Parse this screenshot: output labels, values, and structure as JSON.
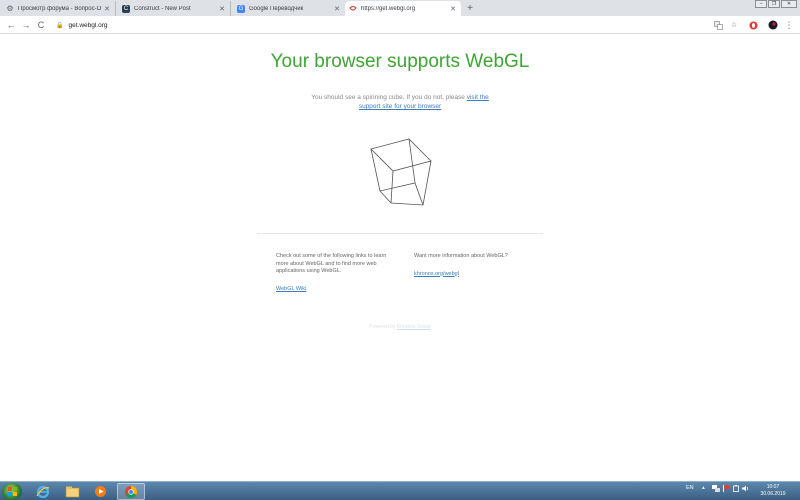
{
  "tabs": [
    {
      "title": "Просмотр форума - Вопрос-О",
      "icon": "gear-icon",
      "close": "✕"
    },
    {
      "title": "Construct - New Post",
      "icon": "construct-icon",
      "close": "✕"
    },
    {
      "title": "Google Переводчик",
      "icon": "google-translate-icon",
      "close": "✕"
    },
    {
      "title": "https://get.webgl.org",
      "icon": "webgl-icon",
      "close": "✕"
    }
  ],
  "new_tab": "+",
  "window_controls": [
    "–",
    "❐",
    "✕"
  ],
  "address": "get.webgl.org",
  "nav": {
    "back": "←",
    "forward": "→",
    "reload": "C"
  },
  "page": {
    "headline": "Your browser supports WebGL",
    "lead_text": "You should see a spinning cube. If you do not, please ",
    "lead_link": "visit the support site for your browser",
    "left_col_text": "Check out some of the following links to learn more about WebGL and to find more web applications using WebGL.",
    "left_col_link": "WebGL Wiki",
    "right_col_text": "Want more information about WebGL?",
    "right_col_link": "khronos.org/webgl",
    "powered_text": "Powered by ",
    "powered_link": "Khronos Group"
  },
  "tray": {
    "language": "EN",
    "time": "10:07",
    "date": "30.06.2019"
  },
  "colors": {
    "headline": "#3ea534",
    "link": "#3a7ebf",
    "taskbar": "#4a7296"
  }
}
